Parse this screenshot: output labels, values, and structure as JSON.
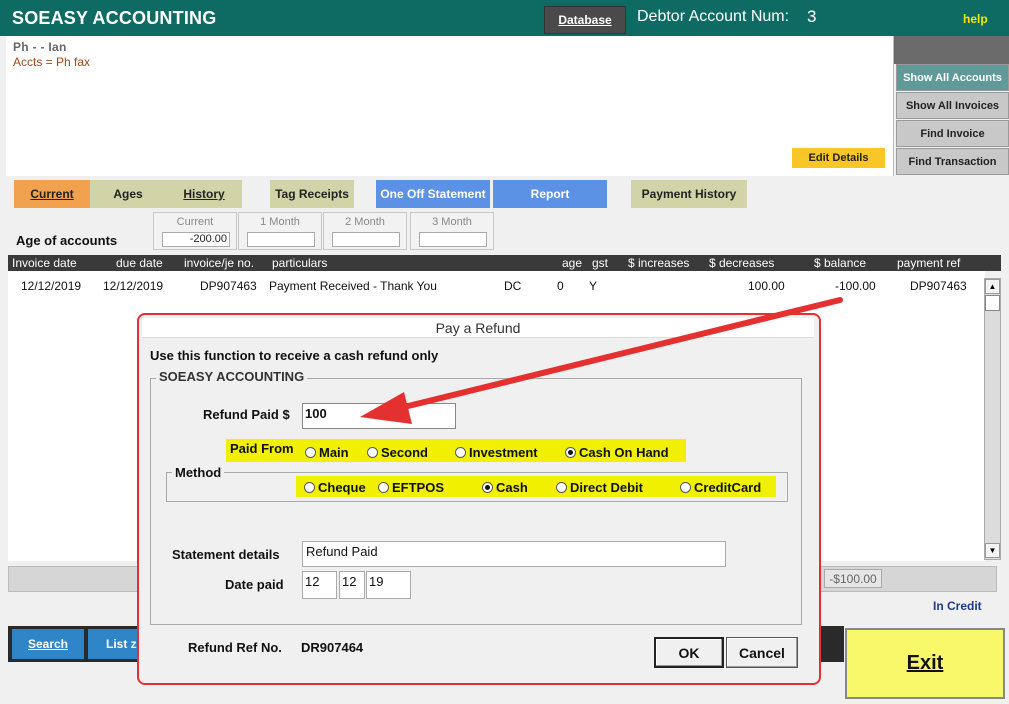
{
  "header": {
    "app_title": "SOEASY ACCOUNTING",
    "database_button": "Database",
    "debtor_label": "Debtor Account Num:",
    "debtor_number": "3",
    "help_link": "help"
  },
  "info": {
    "line1": "Ph  -  - Ian",
    "line2": "Accts =  Ph  fax",
    "edit_details": "Edit Details"
  },
  "side_buttons": {
    "show_all_accounts": "Show All Accounts",
    "show_all_invoices": "Show All Invoices",
    "find_invoice": "Find Invoice",
    "find_transaction": "Find Transaction"
  },
  "tabs": {
    "current": "Current",
    "ages": "Ages",
    "history": "History",
    "tag_receipts": "Tag Receipts",
    "one_off_statement": "One Off Statement",
    "report": "Report",
    "payment_history": "Payment History"
  },
  "ages": {
    "label": "Age of accounts",
    "current_title": "Current",
    "current_value": "-200.00",
    "month1_title": "1 Month",
    "month1_value": "",
    "month2_title": "2 Month",
    "month2_value": "",
    "month3_title": "3 Month",
    "month3_value": ""
  },
  "table": {
    "headers": [
      "Invoice date",
      "due date",
      "invoice/je no.",
      "particulars",
      "age",
      "gst",
      "$ increases",
      "$ decreases",
      "$ balance",
      "payment ref"
    ],
    "rows": [
      {
        "invoice_date": "12/12/2019",
        "due_date": "12/12/2019",
        "invoice_no": "DP907463",
        "particulars": "Payment Received - Thank You",
        "type": "DC",
        "age": "0",
        "gst": "Y",
        "increases": "",
        "decreases": "100.00",
        "balance": "-100.00",
        "payment_ref": "DP907463"
      }
    ]
  },
  "totals": {
    "balance": "-$100.00",
    "status": "In Credit"
  },
  "bottom": {
    "search": "Search",
    "list": "List z",
    "exit": "Exit"
  },
  "dialog": {
    "title": "Pay a Refund",
    "instructions": "Use this function to receive a cash refund only",
    "group_label": "SOEASY ACCOUNTING",
    "refund_paid_label": "Refund Paid $",
    "refund_paid_value": "100",
    "paid_from_label": "Paid From",
    "paid_from_options": [
      "Main",
      "Second",
      "Investment",
      "Cash On Hand"
    ],
    "paid_from_selected": "Cash On Hand",
    "method_label": "Method",
    "method_options": [
      "Cheque",
      "EFTPOS",
      "Cash",
      "Direct Debit",
      "CreditCard"
    ],
    "method_selected": "Cash",
    "statement_label": "Statement details",
    "statement_value": "Refund Paid",
    "date_label": "Date paid",
    "date_day": "12",
    "date_month": "12",
    "date_year": "19",
    "ref_label": "Refund Ref No.",
    "ref_value": "DR907464",
    "ok": "OK",
    "cancel": "Cancel"
  },
  "colors": {
    "header": "#0e6b64",
    "accent_yellow": "#f0f000",
    "annotation_red": "#e53030",
    "tab_blue": "#5b92e5",
    "tab_orange": "#f2a24e"
  }
}
